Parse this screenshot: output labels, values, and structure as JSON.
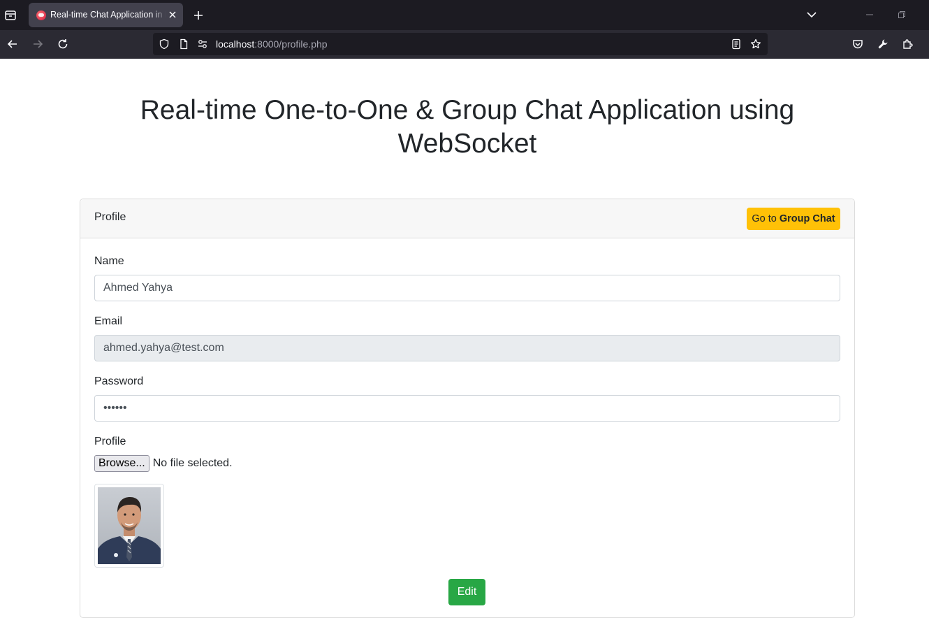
{
  "browser": {
    "tab_title": "Real-time Chat Application in PHP",
    "url_host": "localhost",
    "url_rest": ":8000/profile.php"
  },
  "page": {
    "title": "Real-time One-to-One & Group Chat Application using WebSocket"
  },
  "card": {
    "header_title": "Profile",
    "group_button_prefix": "Go to",
    "group_button_bold": "Group Chat"
  },
  "form": {
    "name_label": "Name",
    "name_value": "Ahmed Yahya",
    "email_label": "Email",
    "email_value": "ahmed.yahya@test.com",
    "password_label": "Password",
    "password_value": "123456",
    "profile_label": "Profile",
    "browse_label": "Browse...",
    "file_status": "No file selected.",
    "edit_label": "Edit"
  },
  "colors": {
    "warning": "#ffc107",
    "success": "#28a745",
    "chrome_dark": "#1c1b22",
    "chrome_nav": "#2b2a33"
  }
}
